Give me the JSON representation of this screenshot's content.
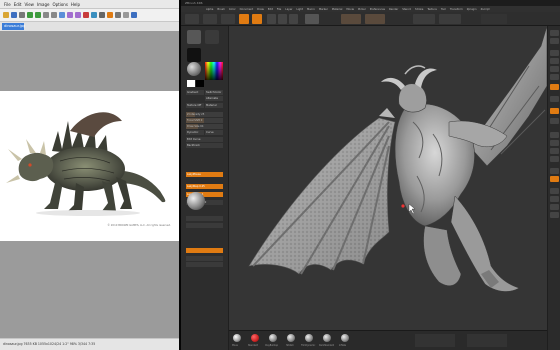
{
  "viewer": {
    "menu": [
      "File",
      "Edit",
      "View",
      "Image",
      "Options",
      "Help"
    ],
    "tab_label": "dinosaur.jpg",
    "copyright": "© 2010 BROWN GAMES, LLC. All rights reserved.",
    "status": "dinosaur.jpg  7635 KB  1055x1024/24  1:2\"  98%  3/344  7:35"
  },
  "zbrush": {
    "title": "ZBrush 4R6",
    "menu": [
      "Alpha",
      "Brush",
      "Color",
      "Document",
      "Draw",
      "Edit",
      "File",
      "Layer",
      "Light",
      "Macro",
      "Marker",
      "Material",
      "Movie",
      "Picker",
      "Preferences",
      "Render",
      "Stencil",
      "Stroke",
      "Texture",
      "Tool",
      "Transform",
      "Zplugin",
      "Zscript"
    ],
    "top_buttons": [
      "Projection Master",
      "LightBox",
      "Quick Sketch",
      "Edit",
      "Draw",
      "Move",
      "Scale",
      "Rotate"
    ],
    "left_panel_labels": [
      "Gradient",
      "SwitchColor",
      "Alternate",
      "Texture Off",
      "Material",
      "Z Intensity 25",
      "Focal Shift 0",
      "Draw Size 64",
      "Dynamic",
      "Curve",
      "Edit Curve",
      "Backtrack",
      "LazyMouse",
      "LazyStep 0.25",
      "LazyRadius 1",
      "Lazy Smooth 0"
    ],
    "bottom_brushes": [
      "Move",
      "Standard",
      "ClayBuildup",
      "hPolish",
      "TrimDynamic",
      "DamStandard",
      "Inflate"
    ],
    "accent": "#e07b12"
  }
}
